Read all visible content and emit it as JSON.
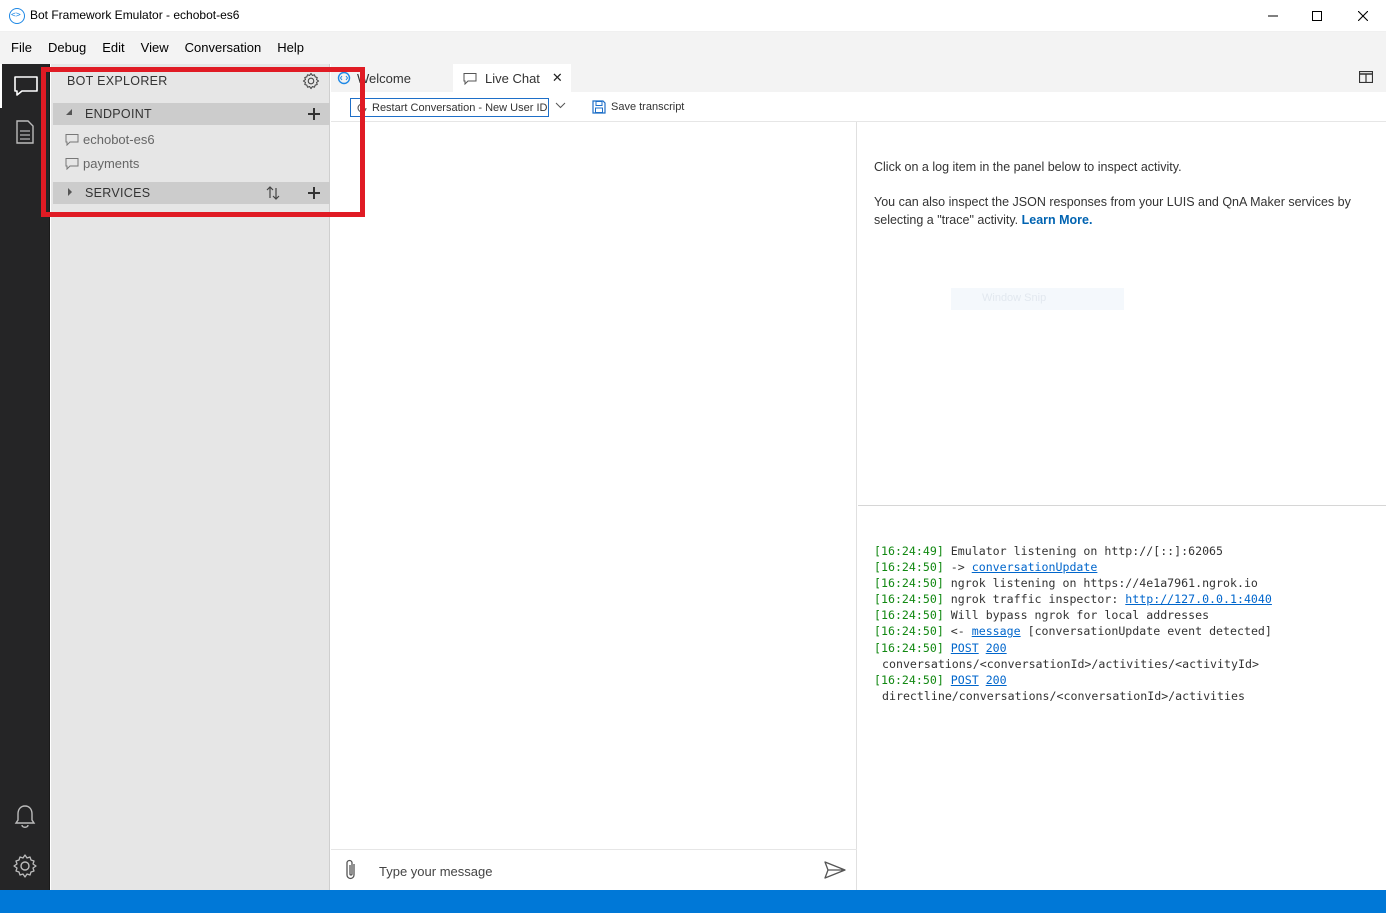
{
  "window": {
    "title": "Bot Framework Emulator - echobot-es6"
  },
  "menu": [
    "File",
    "Debug",
    "Edit",
    "View",
    "Conversation",
    "Help"
  ],
  "activity_bar": {
    "items": [
      "chat-icon",
      "document-icon",
      "bell-icon",
      "gear-icon"
    ]
  },
  "explorer": {
    "header": "BOT EXPLORER",
    "endpoint_section": "ENDPOINT",
    "endpoints": [
      "echobot-es6",
      "payments"
    ],
    "services_section": "SERVICES"
  },
  "tabs": {
    "welcome": "Welcome",
    "live_chat": "Live Chat",
    "close": "✕"
  },
  "toolbar": {
    "restart": "Restart Conversation - New User ID",
    "save_transcript": "Save transcript"
  },
  "inspector": {
    "line1": "Click on a log item in the panel below to inspect activity.",
    "line2": "You can also inspect the JSON responses from your LUIS and QnA Maker services by selecting a \"trace\" activity.",
    "learn_more": "Learn More.",
    "ghost": "Window Snip"
  },
  "log": {
    "entries": [
      {
        "ts": "[16:24:49]",
        "pre": " Emulator listening on http://[::]:62065",
        "link": "",
        "post": ""
      },
      {
        "ts": "[16:24:50]",
        "pre": " -> ",
        "link": "conversationUpdate",
        "post": ""
      },
      {
        "ts": "[16:24:50]",
        "pre": " ngrok listening on https://4e1a7961.ngrok.io",
        "link": "",
        "post": ""
      },
      {
        "ts": "[16:24:50]",
        "pre": " ngrok traffic inspector: ",
        "link": "http://127.0.0.1:4040",
        "post": ""
      },
      {
        "ts": "[16:24:50]",
        "pre": " Will bypass ngrok for local addresses",
        "link": "",
        "post": ""
      },
      {
        "ts": "[16:24:50]",
        "pre": " <- ",
        "link": "message",
        "post": " [conversationUpdate event detected]"
      }
    ],
    "posts": [
      {
        "ts": "[16:24:50]",
        "method": "POST",
        "status": "200",
        "path": "conversations/<conversationId>/activities/<activityId>"
      },
      {
        "ts": "[16:24:50]",
        "method": "POST",
        "status": "200",
        "path": "directline/conversations/<conversationId>/activities"
      }
    ]
  },
  "chat": {
    "placeholder": "Type your message"
  },
  "colors": {
    "accent": "#0078d7",
    "highlight": "#e01b24",
    "timestamp": "#118811",
    "link": "#0066cc"
  }
}
